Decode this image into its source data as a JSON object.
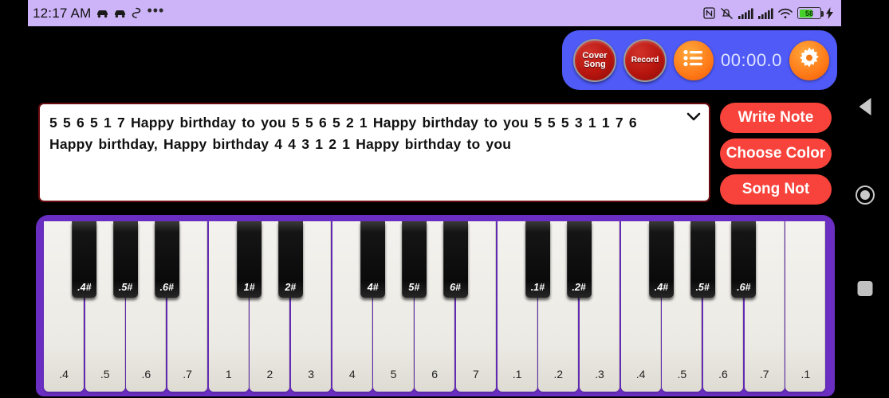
{
  "statusbar": {
    "clock": "12:17 AM",
    "left_icons": [
      "car-icon",
      "car-icon",
      "reddit-snoo-icon",
      "overflow-dots-icon"
    ],
    "right_icons": [
      "nfc-icon",
      "ringer-mute-icon",
      "signal-bars-icon",
      "signal-bars-icon",
      "wifi-icon"
    ],
    "battery_percent": "58",
    "battery_level": 58,
    "charging": true,
    "bg_color": "#cdb3f8"
  },
  "toolbar": {
    "bg_color": "#4f5af7",
    "cover_song_line1": "Cover",
    "cover_song_line2": "Song",
    "record_label": "Record",
    "list_icon": "list-icon",
    "timer": "00:00.0",
    "gear_icon": "gear-icon"
  },
  "note_panel": {
    "text": "5 5 6  5  1 7 Happy birthday to you 5 5 6  5  2 1 Happy birthday to you 5 5 5  3  1 1 7  6 Happy birthday, Happy birthday 4 4 3  1  2 1 Happy birthday to you",
    "chevron_icon": "chevron-down-icon",
    "border_color": "#6b0d10"
  },
  "side_buttons": {
    "color": "#f7433b",
    "items": [
      {
        "label": "Write Note",
        "name": "write-note-button"
      },
      {
        "label": "Choose Color",
        "name": "choose-color-button"
      },
      {
        "label": "Song Not",
        "name": "song-not-button"
      }
    ]
  },
  "piano": {
    "frame_color": "#6a2fc2",
    "white_keys": [
      ".4",
      ".5",
      ".6",
      ".7",
      "1",
      "2",
      "3",
      "4",
      "5",
      "6",
      "7",
      ".1",
      ".2",
      ".3",
      ".4",
      ".5",
      ".6",
      ".7",
      ".1"
    ],
    "black_keys": [
      {
        "label": ".4#",
        "after_white_index": 0
      },
      {
        "label": ".5#",
        "after_white_index": 1
      },
      {
        "label": ".6#",
        "after_white_index": 2
      },
      {
        "label": "1#",
        "after_white_index": 4
      },
      {
        "label": "2#",
        "after_white_index": 5
      },
      {
        "label": "4#",
        "after_white_index": 7
      },
      {
        "label": "5#",
        "after_white_index": 8
      },
      {
        "label": "6#",
        "after_white_index": 9
      },
      {
        "label": ".1#",
        "after_white_index": 11
      },
      {
        "label": ".2#",
        "after_white_index": 12
      },
      {
        "label": ".4#",
        "after_white_index": 14
      },
      {
        "label": ".5#",
        "after_white_index": 15
      },
      {
        "label": ".6#",
        "after_white_index": 16
      }
    ]
  },
  "navbar": {
    "back_icon": "back-triangle-icon",
    "home_icon": "home-circle-icon",
    "recents_icon": "recents-square-icon"
  }
}
